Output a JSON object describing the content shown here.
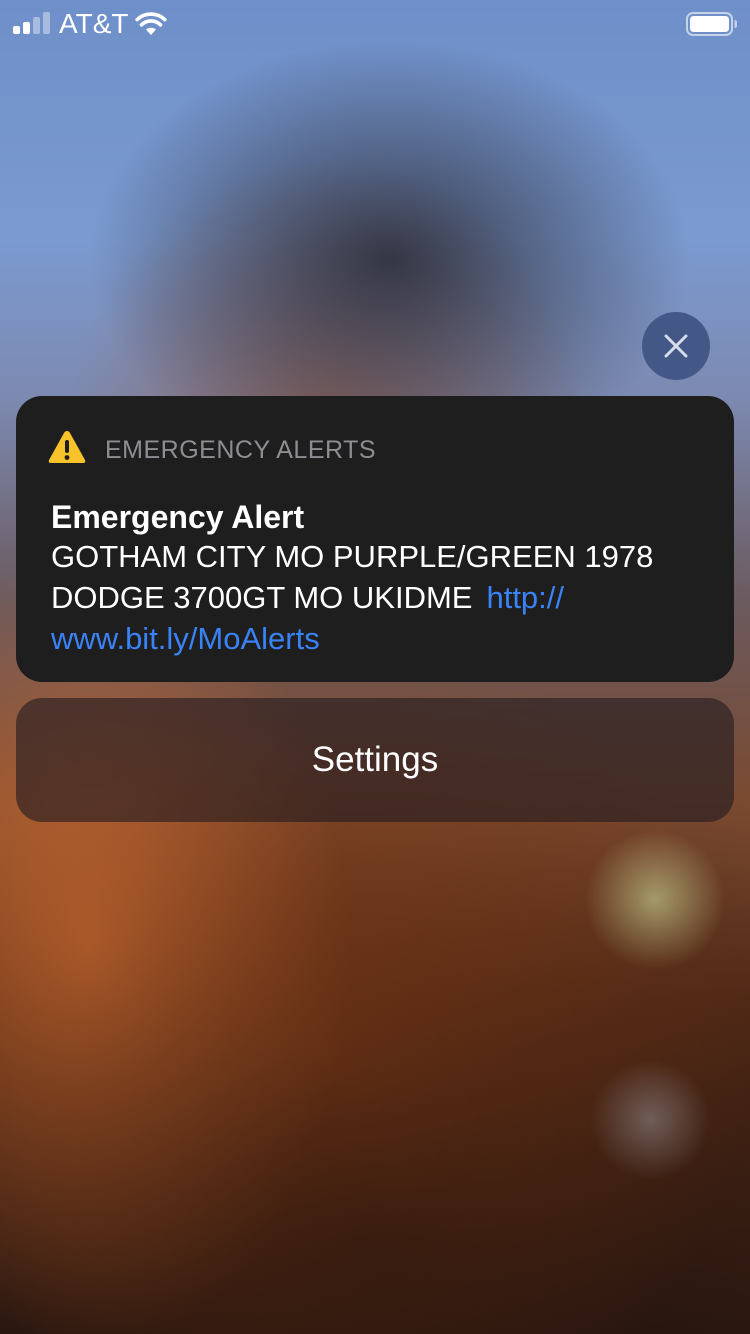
{
  "status_bar": {
    "carrier": "AT&T",
    "signal_bars_filled": 2,
    "signal_bars_total": 4,
    "wifi_icon": "wifi-icon",
    "battery_icon": "battery-icon"
  },
  "close_button": {
    "icon": "close-icon"
  },
  "alert": {
    "app_icon": "warning-icon",
    "app_name": "EMERGENCY ALERTS",
    "title": "Emergency Alert",
    "body_line_1": "GOTHAM CITY MO PURPLE/GREEN 1978",
    "body_line_2": "DODGE 3700GT MO UKIDME",
    "link_part_1": "http://",
    "link_part_2": "www.bit.ly/MoAlerts"
  },
  "settings_button": {
    "label": "Settings"
  },
  "colors": {
    "card_background": "#1e1e1f",
    "link": "#3a82f7",
    "app_name": "#8d8d93",
    "warning_yellow": "#f7c22a",
    "close_button": "#3e5282"
  }
}
